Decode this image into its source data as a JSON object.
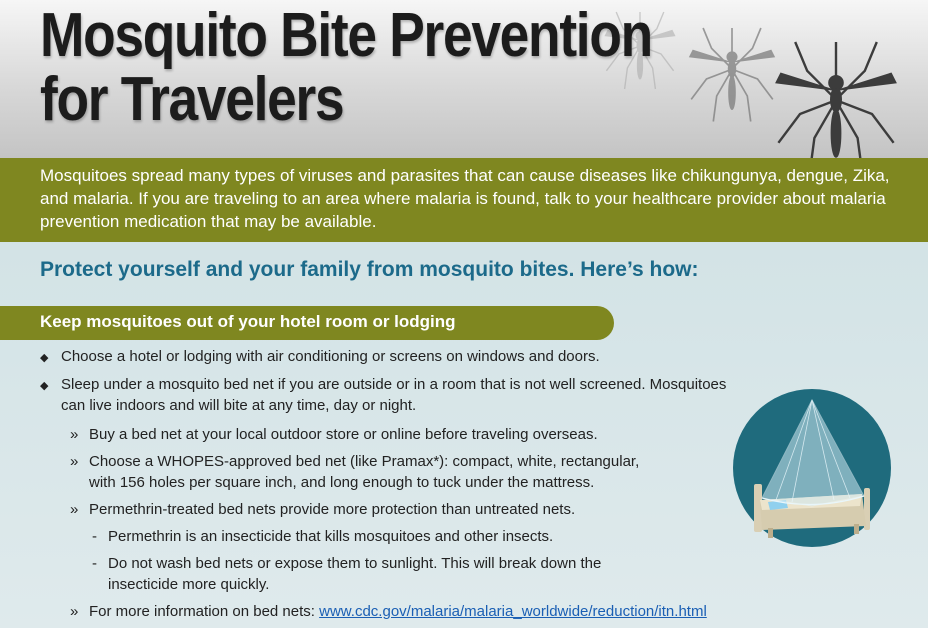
{
  "header": {
    "title_line1": "Mosquito Bite Prevention",
    "title_line2": "for Travelers"
  },
  "intro": {
    "text": "Mosquitoes spread many types of viruses and parasites that can cause diseases like chikungunya, dengue, Zika, and malaria.  If you are traveling to an area where malaria is found, talk to your healthcare provider about malaria prevention medication that may be available."
  },
  "protect_heading": "Protect yourself and your family from mosquito bites. Here’s how:",
  "section_heading": "Keep mosquitoes out of your hotel room or lodging",
  "bullets": {
    "b1": "Choose a hotel or lodging with air conditioning or screens on windows and doors.",
    "b2_line1": "Sleep under a mosquito bed net if you are outside or in a room that is not well screened.  Mosquitoes",
    "b2_line2": "can live indoors and will bite at any time, day or night.",
    "s1": "Buy a bed net at your local outdoor store or online before traveling overseas.",
    "s2_line1": "Choose a WHOPES-approved bed net (like Pramax*): compact, white, rectangular,",
    "s2_line2": "with 156 holes per square inch, and long enough to tuck under the mattress.",
    "s3": "Permethrin-treated bed nets provide more protection than untreated nets.",
    "d1": "Permethrin is an insecticide that kills mosquitoes and other insects.",
    "d2_line1": "Do not wash bed nets or expose them to sunlight.  This will break down the",
    "d2_line2": "insecticide more quickly.",
    "s4_text": "For more information on bed nets:",
    "s4_link": "www.cdc.gov/malaria/malaria_worldwide/reduction/itn.html"
  },
  "markers": {
    "bullet": "◆",
    "sub": "»",
    "dash": "-"
  },
  "colors": {
    "olive": "#7f8720",
    "heading_blue": "#1c6a8a",
    "link": "#1a5fb4",
    "badge": "#1f6b7d"
  },
  "icons": [
    "mosquito-icon",
    "bed-net-icon",
    "diamond-bullet-icon"
  ]
}
